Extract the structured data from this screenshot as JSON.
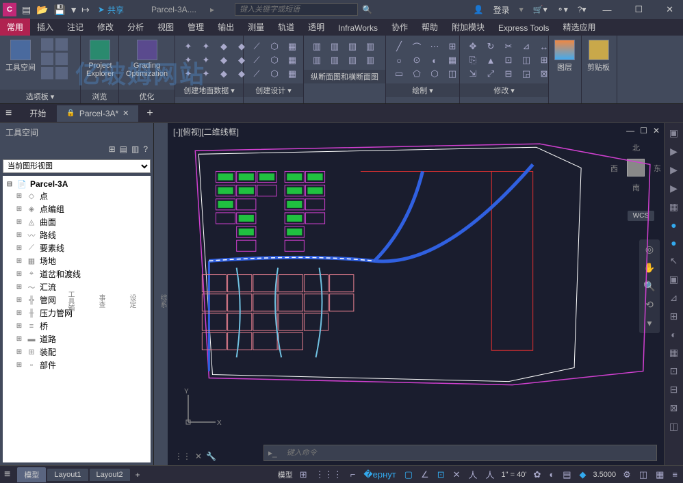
{
  "title": {
    "share": "共享",
    "doc": "Parcel-3A....",
    "search_placeholder": "键入关键字或短语",
    "login": "登录"
  },
  "ribbon_tabs": [
    "常用",
    "插入",
    "注记",
    "修改",
    "分析",
    "视图",
    "管理",
    "输出",
    "测量",
    "轨道",
    "透明",
    "InfraWorks",
    "协作",
    "帮助",
    "附加模块",
    "Express Tools",
    "精选应用"
  ],
  "ribbon_panels": {
    "p1_big": "工具空间",
    "p1_label": "选项板 ▾",
    "p2_big": "Project Explorer",
    "p2_label": "浏览",
    "p3_big": "Grading Optimization",
    "p3_label": "优化",
    "p4_label": "创建地面数据 ▾",
    "p5_label": "创建设计 ▾",
    "p6_label": "纵断面图和横断面图",
    "p7_label": "绘制 ▾",
    "p8_label": "修改 ▾",
    "p9_big": "图层",
    "p10_big": "剪贴板"
  },
  "doc_tabs": {
    "start": "开始",
    "active": "Parcel-3A*"
  },
  "left_panel": {
    "title": "工具空间",
    "selector": "当前图形视图",
    "tree_root": "Parcel-3A",
    "tree": [
      "点",
      "点编组",
      "曲面",
      "路线",
      "要素线",
      "场地",
      "道岔和渡线",
      "汇流",
      "管网",
      "压力管网",
      "桥",
      "道路",
      "装配",
      "部件"
    ]
  },
  "side_strip": [
    "综系",
    "设定",
    "事查",
    "工具箱"
  ],
  "canvas": {
    "header": "[-][俯视][二维线框]",
    "wcs": "WCS",
    "viewcube": {
      "n": "北",
      "s": "南",
      "e": "东",
      "w": "西"
    },
    "cmd_placeholder": "键入命令"
  },
  "statusbar": {
    "tabs": [
      "模型",
      "Layout1",
      "Layout2"
    ],
    "model_btn": "模型",
    "scale": "1\" = 40'",
    "coord": "3.5000"
  },
  "watermark": "亿玻姆网站"
}
